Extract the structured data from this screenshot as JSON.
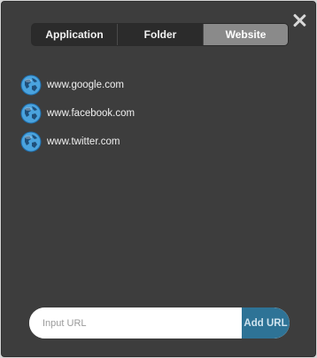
{
  "tabs": [
    {
      "label": "Application",
      "active": false
    },
    {
      "label": "Folder",
      "active": false
    },
    {
      "label": "Website",
      "active": true
    }
  ],
  "urls": [
    {
      "text": "www.google.com",
      "icon": "globe-icon"
    },
    {
      "text": "www.facebook.com",
      "icon": "globe-icon"
    },
    {
      "text": "www.twitter.com",
      "icon": "globe-icon"
    }
  ],
  "input": {
    "placeholder": "Input URL",
    "value": ""
  },
  "add_button": {
    "label": "Add URL"
  },
  "close_icon": "close-icon",
  "colors": {
    "background": "#3d3d3d",
    "tab_active": "#8a8a8a",
    "tab_inactive": "#2b2b2b",
    "accent": "#2e7396"
  }
}
